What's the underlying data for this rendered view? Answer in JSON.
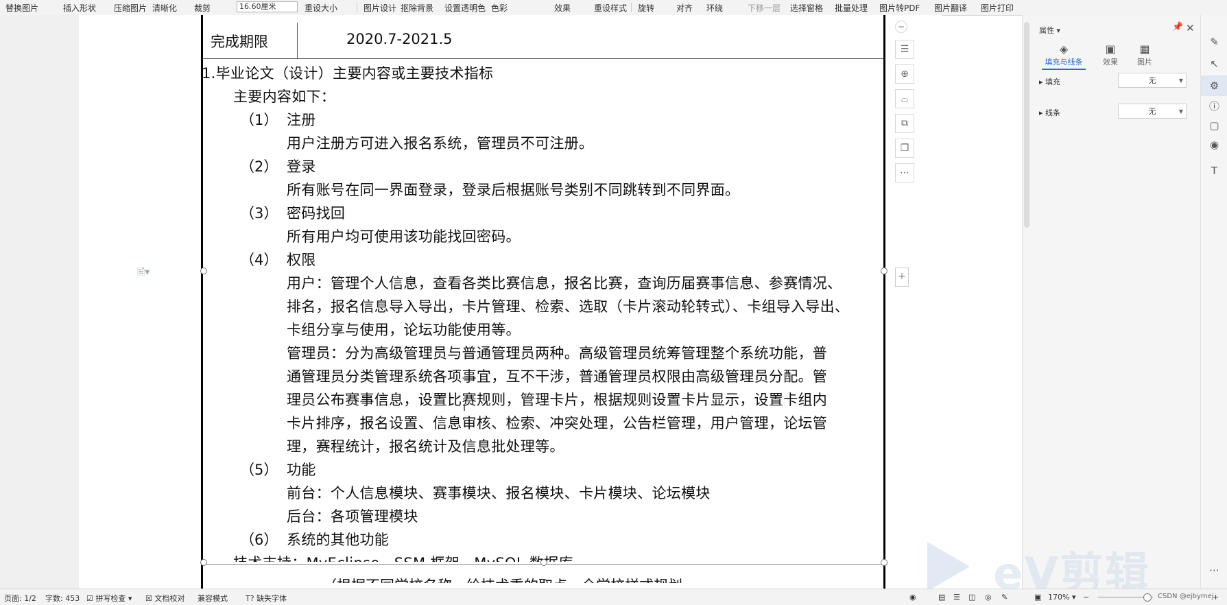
{
  "toolbar": {
    "items": [
      "替换图片",
      "插入形状",
      "压缩图片",
      "清晰化",
      "裁剪",
      "重设大小",
      "图片设计",
      "抠除背景",
      "设置透明色",
      "色彩",
      "效果",
      "重设样式",
      "旋转",
      "对齐",
      "环绕",
      "下移一层",
      "选择窗格",
      "批量处理",
      "图片转PDF",
      "图片翻译",
      "图片打印"
    ],
    "size_value": "16.60厘米"
  },
  "document": {
    "row_label": "完成期限",
    "row_value": "2020.7-2021.5",
    "heading": "1.毕业论文（设计）主要内容或主要技术指标",
    "intro": "主要内容如下：",
    "sections": [
      {
        "num": "（1）",
        "title": "注册",
        "lines": [
          "用户注册方可进入报名系统，管理员不可注册。"
        ]
      },
      {
        "num": "（2）",
        "title": "登录",
        "lines": [
          "所有账号在同一界面登录，登录后根据账号类别不同跳转到不同界面。"
        ]
      },
      {
        "num": "（3）",
        "title": "密码找回",
        "lines": [
          "所有用户均可使用该功能找回密码。"
        ]
      },
      {
        "num": "（4）",
        "title": "权限",
        "lines": [
          "用户：管理个人信息，查看各类比赛信息，报名比赛，查询历届赛事信息、参赛情况、",
          "排名，报名信息导入导出，卡片管理、检索、选取（卡片滚动轮转式）、卡组导入导出、",
          "卡组分享与使用，论坛功能使用等。",
          "管理员：分为高级管理员与普通管理员两种。高级管理员统筹管理整个系统功能，普",
          "通管理员分类管理系统各项事宜，互不干涉，普通管理员权限由高级管理员分配。管",
          "理员公布赛事信息，设置比赛规则，管理卡片，根据规则设置卡片显示，设置卡组内",
          "卡片排序，报名设置、信息审核、检索、冲突处理，公告栏管理，用户管理，论坛管",
          "理，赛程统计，报名统计及信息批处理等。"
        ]
      },
      {
        "num": "（5）",
        "title": "功能",
        "lines": [
          "前台：个人信息模块、赛事模块、报名模块、卡片模块、论坛模块",
          "后台：各项管理模块"
        ]
      },
      {
        "num": "（6）",
        "title": "系统的其他功能",
        "lines": []
      }
    ],
    "tech_line": "技术支持：MyEclipse、SSM 框架、MySQL 数据库",
    "cut_line": "（根据不同学校名称、给技术重的取点、全学校样式规划"
  },
  "properties": {
    "title": "属性",
    "tabs": [
      "填充与线条",
      "效果",
      "图片"
    ],
    "fill_label": "填充",
    "fill_value": "无",
    "line_label": "线条",
    "line_value": "无"
  },
  "status": {
    "page": "页面: 1/2",
    "words": "字数: 453",
    "spell": "拼写检查",
    "proof": "文档校对",
    "compat": "兼容模式",
    "missing_font": "缺失字体",
    "zoom": "170%",
    "credit": "CSDN @ejbymej"
  },
  "watermark": "eV剪辑"
}
